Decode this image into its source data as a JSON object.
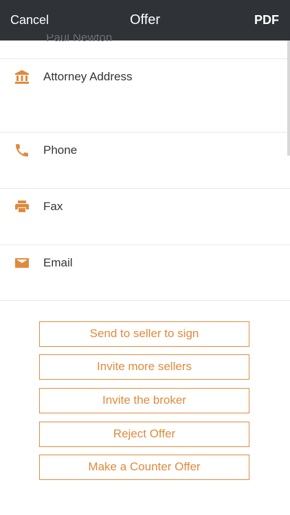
{
  "header": {
    "cancel_label": "Cancel",
    "title": "Offer",
    "pdf_label": "PDF"
  },
  "attorney": {
    "name_partial": "Paul Newton"
  },
  "fields": [
    {
      "label": "Attorney Address",
      "icon": "bank-icon"
    },
    {
      "label": "Phone",
      "icon": "phone-icon"
    },
    {
      "label": "Fax",
      "icon": "printer-icon"
    },
    {
      "label": "Email",
      "icon": "envelope-icon"
    }
  ],
  "actions": [
    {
      "label": "Send to seller to sign"
    },
    {
      "label": "Invite more sellers"
    },
    {
      "label": "Invite the broker"
    },
    {
      "label": "Reject Offer"
    },
    {
      "label": "Make a Counter Offer"
    }
  ],
  "colors": {
    "accent": "#e08a3c",
    "header_bg": "#2f3237"
  }
}
